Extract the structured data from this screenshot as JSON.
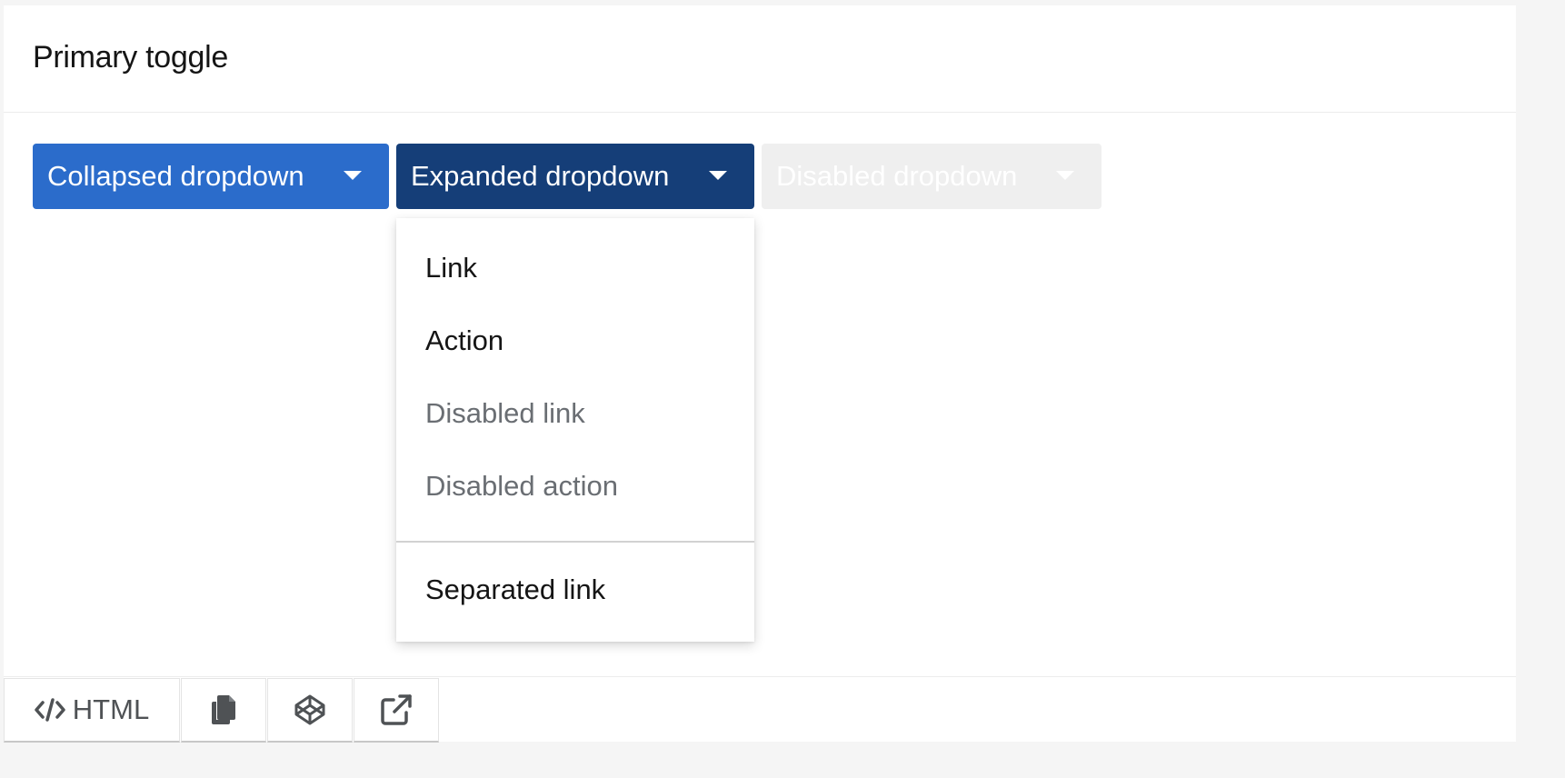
{
  "card": {
    "title": "Primary toggle"
  },
  "toggles": {
    "collapsed_label": "Collapsed dropdown",
    "expanded_label": "Expanded dropdown",
    "disabled_label": "Disabled dropdown"
  },
  "menu": {
    "items": [
      {
        "label": "Link",
        "disabled": false
      },
      {
        "label": "Action",
        "disabled": false
      },
      {
        "label": "Disabled link",
        "disabled": true
      },
      {
        "label": "Disabled action",
        "disabled": true
      }
    ],
    "separated_item": {
      "label": "Separated link",
      "disabled": false
    }
  },
  "toolbar": {
    "html_label": "HTML",
    "icons": [
      "code-icon",
      "copy-icon",
      "codepen-icon",
      "external-link-icon"
    ]
  },
  "colors": {
    "primary": "#2b6ccb",
    "primary_expanded": "#153e78",
    "disabled_bg": "#efefef",
    "disabled_text": "#6a6e73"
  }
}
